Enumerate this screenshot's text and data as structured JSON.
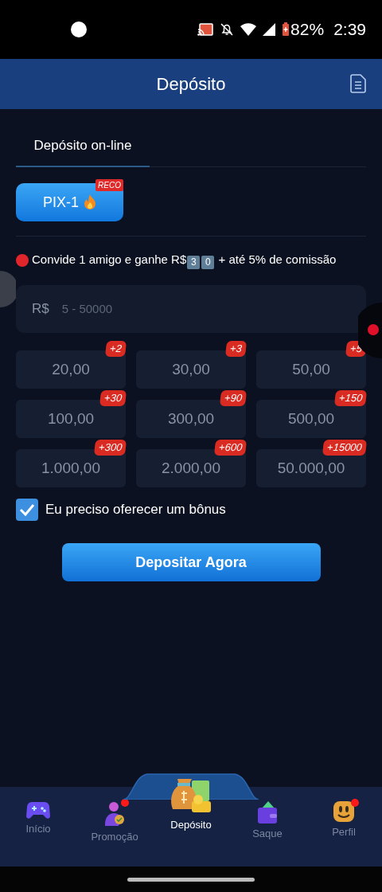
{
  "status_bar": {
    "battery": "82%",
    "time": "2:39"
  },
  "header": {
    "title": "Depósito"
  },
  "tabs": [
    {
      "label": "Depósito on-line",
      "selected": true
    }
  ],
  "methods": [
    {
      "label": "PIX-1",
      "tag": "RECO",
      "selected": true
    }
  ],
  "promo": {
    "before": "Convide 1 amigo e ganhe R$",
    "keycaps": [
      "3",
      "0"
    ],
    "after": "+ até 5% de comissão"
  },
  "amount_field": {
    "prefix": "R$",
    "placeholder": "5 - 50000"
  },
  "amounts": [
    {
      "value": "20,00",
      "bonus": "+2"
    },
    {
      "value": "30,00",
      "bonus": "+3"
    },
    {
      "value": "50,00",
      "bonus": "+5"
    },
    {
      "value": "100,00",
      "bonus": "+30"
    },
    {
      "value": "300,00",
      "bonus": "+90"
    },
    {
      "value": "500,00",
      "bonus": "+150"
    },
    {
      "value": "1.000,00",
      "bonus": "+300"
    },
    {
      "value": "2.000,00",
      "bonus": "+600"
    },
    {
      "value": "50.000,00",
      "bonus": "+15000"
    }
  ],
  "bonus_option": {
    "label": "Eu preciso oferecer um bônus",
    "checked": true
  },
  "submit": "Depositar Agora",
  "bottom_nav": [
    {
      "label": "Início",
      "kind": "gamepad",
      "selected": false,
      "badge": false
    },
    {
      "label": "Promoção",
      "kind": "person",
      "selected": false,
      "badge": true
    },
    {
      "label": "Depósito",
      "kind": "moneybag",
      "selected": true,
      "badge": false
    },
    {
      "label": "Saque",
      "kind": "wallet",
      "selected": false,
      "badge": false
    },
    {
      "label": "Perfil",
      "kind": "smiley",
      "selected": false,
      "badge": true
    }
  ]
}
